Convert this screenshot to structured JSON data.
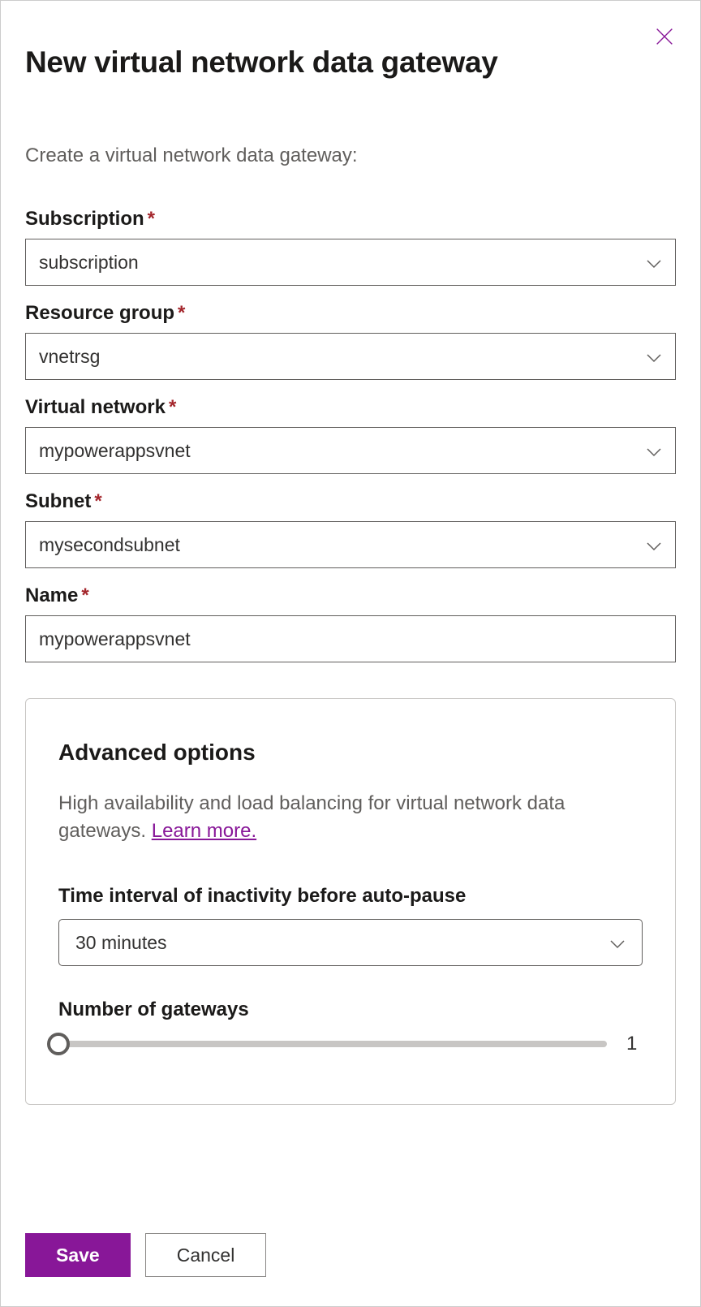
{
  "header": {
    "title": "New virtual network data gateway",
    "subtitle": "Create a virtual network data gateway:"
  },
  "fields": {
    "subscription": {
      "label": "Subscription",
      "value": "subscription"
    },
    "resource_group": {
      "label": "Resource group",
      "value": "vnetrsg"
    },
    "virtual_network": {
      "label": "Virtual network",
      "value": "mypowerappsvnet"
    },
    "subnet": {
      "label": "Subnet",
      "value": "mysecondsubnet"
    },
    "name": {
      "label": "Name",
      "value": "mypowerappsvnet"
    }
  },
  "advanced": {
    "title": "Advanced options",
    "description": "High availability and load balancing for virtual network data gateways. ",
    "learn_more": "Learn more.",
    "time_interval": {
      "label": "Time interval of inactivity before auto-pause",
      "value": "30 minutes"
    },
    "gateways": {
      "label": "Number of gateways",
      "value": "1"
    }
  },
  "footer": {
    "save": "Save",
    "cancel": "Cancel"
  },
  "required_marker": "*"
}
